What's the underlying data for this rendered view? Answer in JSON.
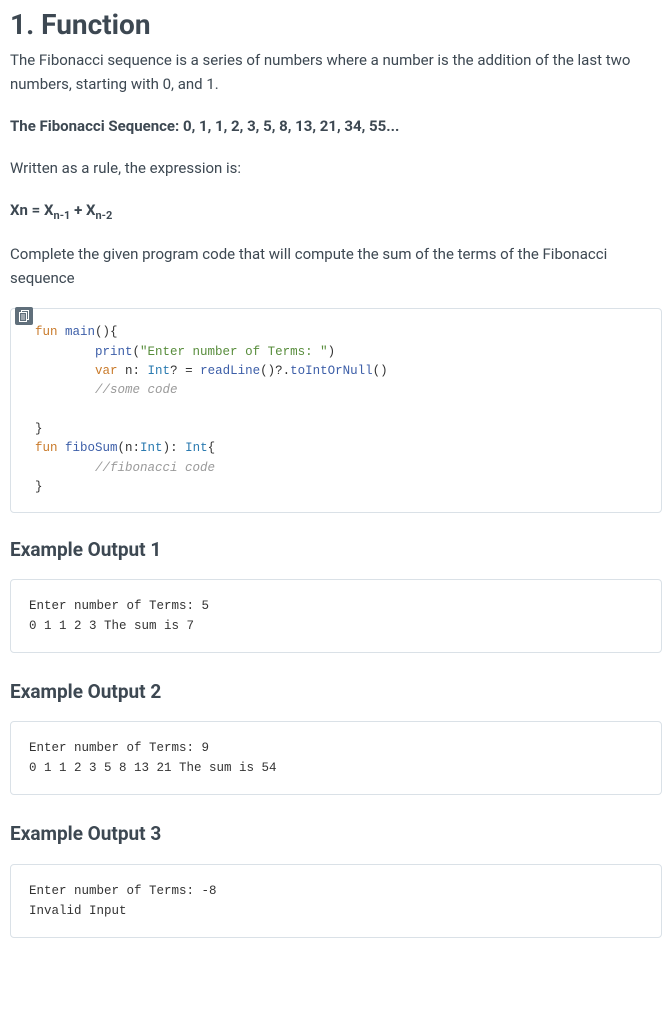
{
  "heading": "1. Function",
  "intro": "The Fibonacci sequence is a series of numbers where a number is the addition of the last two numbers, starting with 0, and 1.",
  "sequenceLine": "The Fibonacci Sequence: 0, 1, 1, 2, 3, 5, 8, 13, 21, 34, 55...",
  "ruleLine": "Written as a rule, the expression is:",
  "formula": {
    "lhs": "Xn",
    "rhs1": "X",
    "sub1": "n-1",
    "plus": " + ",
    "rhs2": "X",
    "sub2": "n-2",
    "eq": " = "
  },
  "task": "Complete the given program code that will compute the sum of the terms of the Fibonacci sequence",
  "code": {
    "l1_kw": "fun",
    "l1_fn": " main",
    "l1_rest": "(){",
    "l2_indent": "        ",
    "l2_fn": "print",
    "l2_paren": "(",
    "l2_str": "\"Enter number of Terms: \"",
    "l2_close": ")",
    "l3_indent": "        ",
    "l3_kw": "var",
    "l3_var": " n: ",
    "l3_type": "Int",
    "l3_q": "? = ",
    "l3_fn1": "readLine",
    "l3_call1": "()?.",
    "l3_fn2": "toIntOrNull",
    "l3_call2": "()",
    "l4_indent": "        ",
    "l4_comment": "//some code",
    "l5": "",
    "l6": "}",
    "l7_kw": "fun",
    "l7_fn": " fiboSum",
    "l7_open": "(n:",
    "l7_type": "Int",
    "l7_mid": "): ",
    "l7_type2": "Int",
    "l7_brace": "{",
    "l8_indent": "        ",
    "l8_comment": "//fibonacci code",
    "l9": "}"
  },
  "examples": [
    {
      "title": "Example Output 1",
      "text": "Enter number of Terms: 5\n0 1 1 2 3 The sum is 7"
    },
    {
      "title": "Example Output 2",
      "text": "Enter number of Terms: 9\n0 1 1 2 3 5 8 13 21 The sum is 54"
    },
    {
      "title": "Example Output 3",
      "text": "Enter number of Terms: -8\nInvalid Input"
    }
  ]
}
